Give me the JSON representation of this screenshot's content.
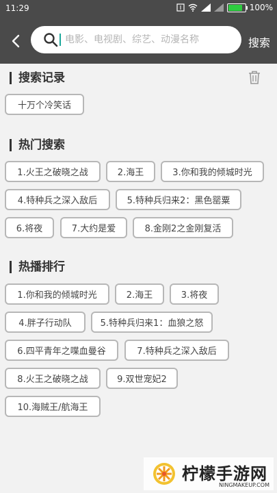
{
  "status_bar": {
    "time": "11:29",
    "battery": "100%"
  },
  "search": {
    "placeholder": "电影、电视剧、综艺、动漫名称",
    "value": "",
    "button_label": "搜索"
  },
  "history": {
    "title": "搜索记录",
    "items": [
      "十万个冷笑话"
    ]
  },
  "hot": {
    "title": "热门搜索",
    "items": [
      "1.火王之破晓之战",
      "2.海王",
      "3.你和我的倾城时光",
      "4.特种兵之深入敌后",
      "5.特种兵归来2：黑色罂粟",
      "6.将夜",
      "7.大约是爱",
      "8.金刚2之金刚复活"
    ]
  },
  "ranking": {
    "title": "热播排行",
    "items": [
      "1.你和我的倾城时光",
      "2.海王",
      "3.将夜",
      "4.胖子行动队",
      "5.特种兵归来1：血狼之怒",
      "6.四平青年之喋血曼谷",
      "7.特种兵之深入敌后",
      "8.火王之破晓之战",
      "9.双世宠妃2",
      "10.海贼王/航海王"
    ]
  },
  "watermark": {
    "text": "柠檬手游网",
    "sub": "NINGMAKEUP.COM"
  },
  "colors": {
    "appbar": "#4a4a4a",
    "battery": "#2ecc40",
    "caret": "#1ba89a",
    "tag_border": "#b7b7b7"
  }
}
